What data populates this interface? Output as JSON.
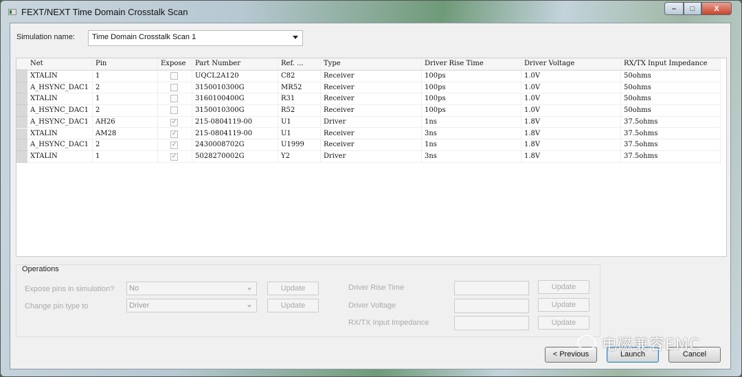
{
  "window": {
    "title": "FEXT/NEXT Time Domain Crosstalk Scan",
    "minimize": "–",
    "maximize": "□",
    "close": "X"
  },
  "simulation": {
    "label": "Simulation name:",
    "value": "Time Domain Crosstalk Scan 1"
  },
  "table": {
    "columns": [
      "Net",
      "Pin",
      "Expose",
      "Part Number",
      "Ref. ...",
      "Type",
      "Driver Rise Time",
      "Driver Voltage",
      "RX/TX Input Impedance"
    ],
    "rows": [
      {
        "net": "XTALIN",
        "pin": "1",
        "expose": false,
        "part": "UQCL2A120",
        "ref": "C82",
        "type": "Receiver",
        "rise": "100ps",
        "voltage": "1.0V",
        "impedance": "50ohms"
      },
      {
        "net": "A_HSYNC_DAC1",
        "pin": "2",
        "expose": false,
        "part": "3150010300G",
        "ref": "MR52",
        "type": "Receiver",
        "rise": "100ps",
        "voltage": "1.0V",
        "impedance": "50ohms"
      },
      {
        "net": "XTALIN",
        "pin": "1",
        "expose": false,
        "part": "3160100400G",
        "ref": "R31",
        "type": "Receiver",
        "rise": "100ps",
        "voltage": "1.0V",
        "impedance": "50ohms"
      },
      {
        "net": "A_HSYNC_DAC1",
        "pin": "2",
        "expose": false,
        "part": "3150010300G",
        "ref": "R52",
        "type": "Receiver",
        "rise": "100ps",
        "voltage": "1.0V",
        "impedance": "50ohms"
      },
      {
        "net": "A_HSYNC_DAC1",
        "pin": "AH26",
        "expose": true,
        "part": "215-0804119-00",
        "ref": "U1",
        "type": "Driver",
        "rise": "1ns",
        "voltage": "1.8V",
        "impedance": "37.5ohms"
      },
      {
        "net": "XTALIN",
        "pin": "AM28",
        "expose": true,
        "part": "215-0804119-00",
        "ref": "U1",
        "type": "Receiver",
        "rise": "3ns",
        "voltage": "1.8V",
        "impedance": "37.5ohms"
      },
      {
        "net": "A_HSYNC_DAC1",
        "pin": "2",
        "expose": true,
        "part": "2430008702G",
        "ref": "U1999",
        "type": "Receiver",
        "rise": "1ns",
        "voltage": "1.8V",
        "impedance": "37.5ohms"
      },
      {
        "net": "XTALIN",
        "pin": "1",
        "expose": true,
        "part": "5028270002G",
        "ref": "Y2",
        "type": "Driver",
        "rise": "3ns",
        "voltage": "1.8V",
        "impedance": "37.5ohms"
      }
    ]
  },
  "operations": {
    "title": "Operations",
    "expose_label": "Expose pins in simulation?",
    "expose_value": "No",
    "pin_type_label": "Change pin type to",
    "pin_type_value": "Driver",
    "rise_label": "Driver Rise Time",
    "voltage_label": "Driver Voltage",
    "impedance_label": "RX/TX Input Impedance",
    "update": "Update"
  },
  "footer": {
    "previous": "< Previous",
    "launch": "Launch",
    "cancel": "Cancel"
  },
  "watermark": "电磁兼容EMC"
}
